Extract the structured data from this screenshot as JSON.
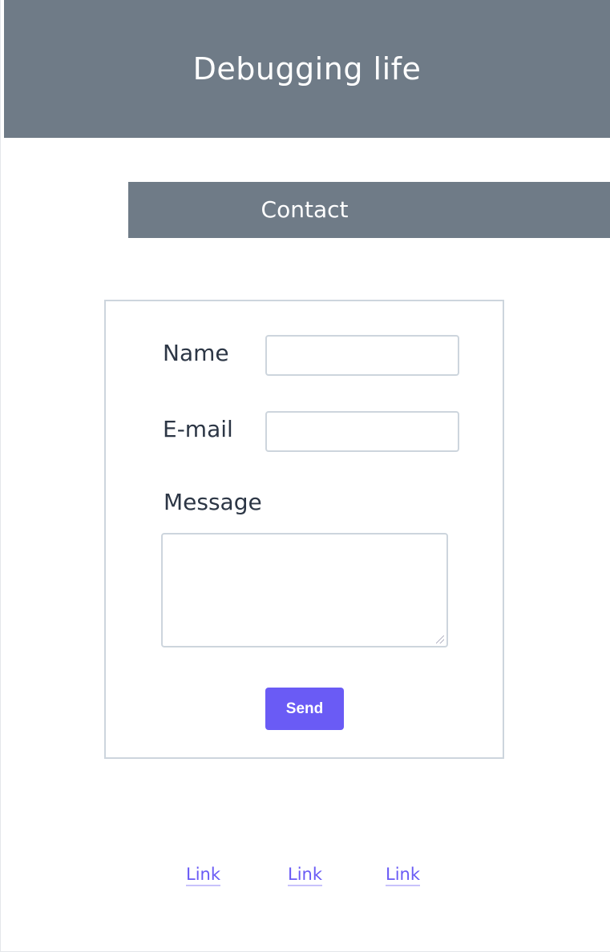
{
  "header": {
    "title": "Debugging life"
  },
  "section": {
    "title": "Contact"
  },
  "form": {
    "name_label": "Name",
    "email_label": "E-mail",
    "message_label": "Message",
    "send_label": "Send"
  },
  "footer": {
    "links": [
      "Link",
      "Link",
      "Link"
    ]
  },
  "colors": {
    "header": "#6f7b87",
    "accent": "#6a5bf5",
    "border": "#cdd5dd"
  }
}
